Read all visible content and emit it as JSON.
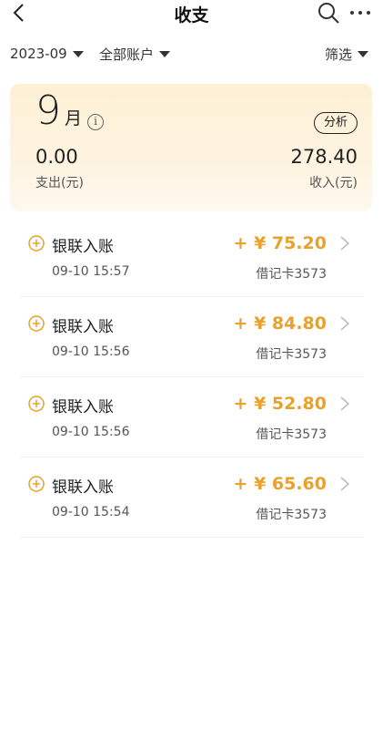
{
  "header": {
    "title": "收支"
  },
  "filters": {
    "month": "2023-09",
    "account": "全部账户",
    "filter": "筛选"
  },
  "summary": {
    "month_number": "9",
    "month_unit": "月",
    "analyze_label": "分析",
    "expense": "0.00",
    "expense_label": "支出(元)",
    "income": "278.40",
    "income_label": "收入(元)"
  },
  "transactions": [
    {
      "name": "银联入账",
      "time": "09-10 15:57",
      "amount": "+ ¥ 75.20",
      "card": "借记卡3573"
    },
    {
      "name": "银联入账",
      "time": "09-10 15:56",
      "amount": "+ ¥ 84.80",
      "card": "借记卡3573"
    },
    {
      "name": "银联入账",
      "time": "09-10 15:56",
      "amount": "+ ¥ 52.80",
      "card": "借记卡3573"
    },
    {
      "name": "银联入账",
      "time": "09-10 15:54",
      "amount": "+ ¥ 65.60",
      "card": "借记卡3573"
    }
  ],
  "icons": {
    "back": "chevron-left-icon",
    "search": "search-icon",
    "more": "more-dots-icon",
    "info": "info-icon",
    "transaction": "income-coin-icon",
    "chevron": "chevron-right-icon"
  },
  "colors": {
    "income_amount": "#e8a12a",
    "card_bg": "#fdf0d5"
  }
}
